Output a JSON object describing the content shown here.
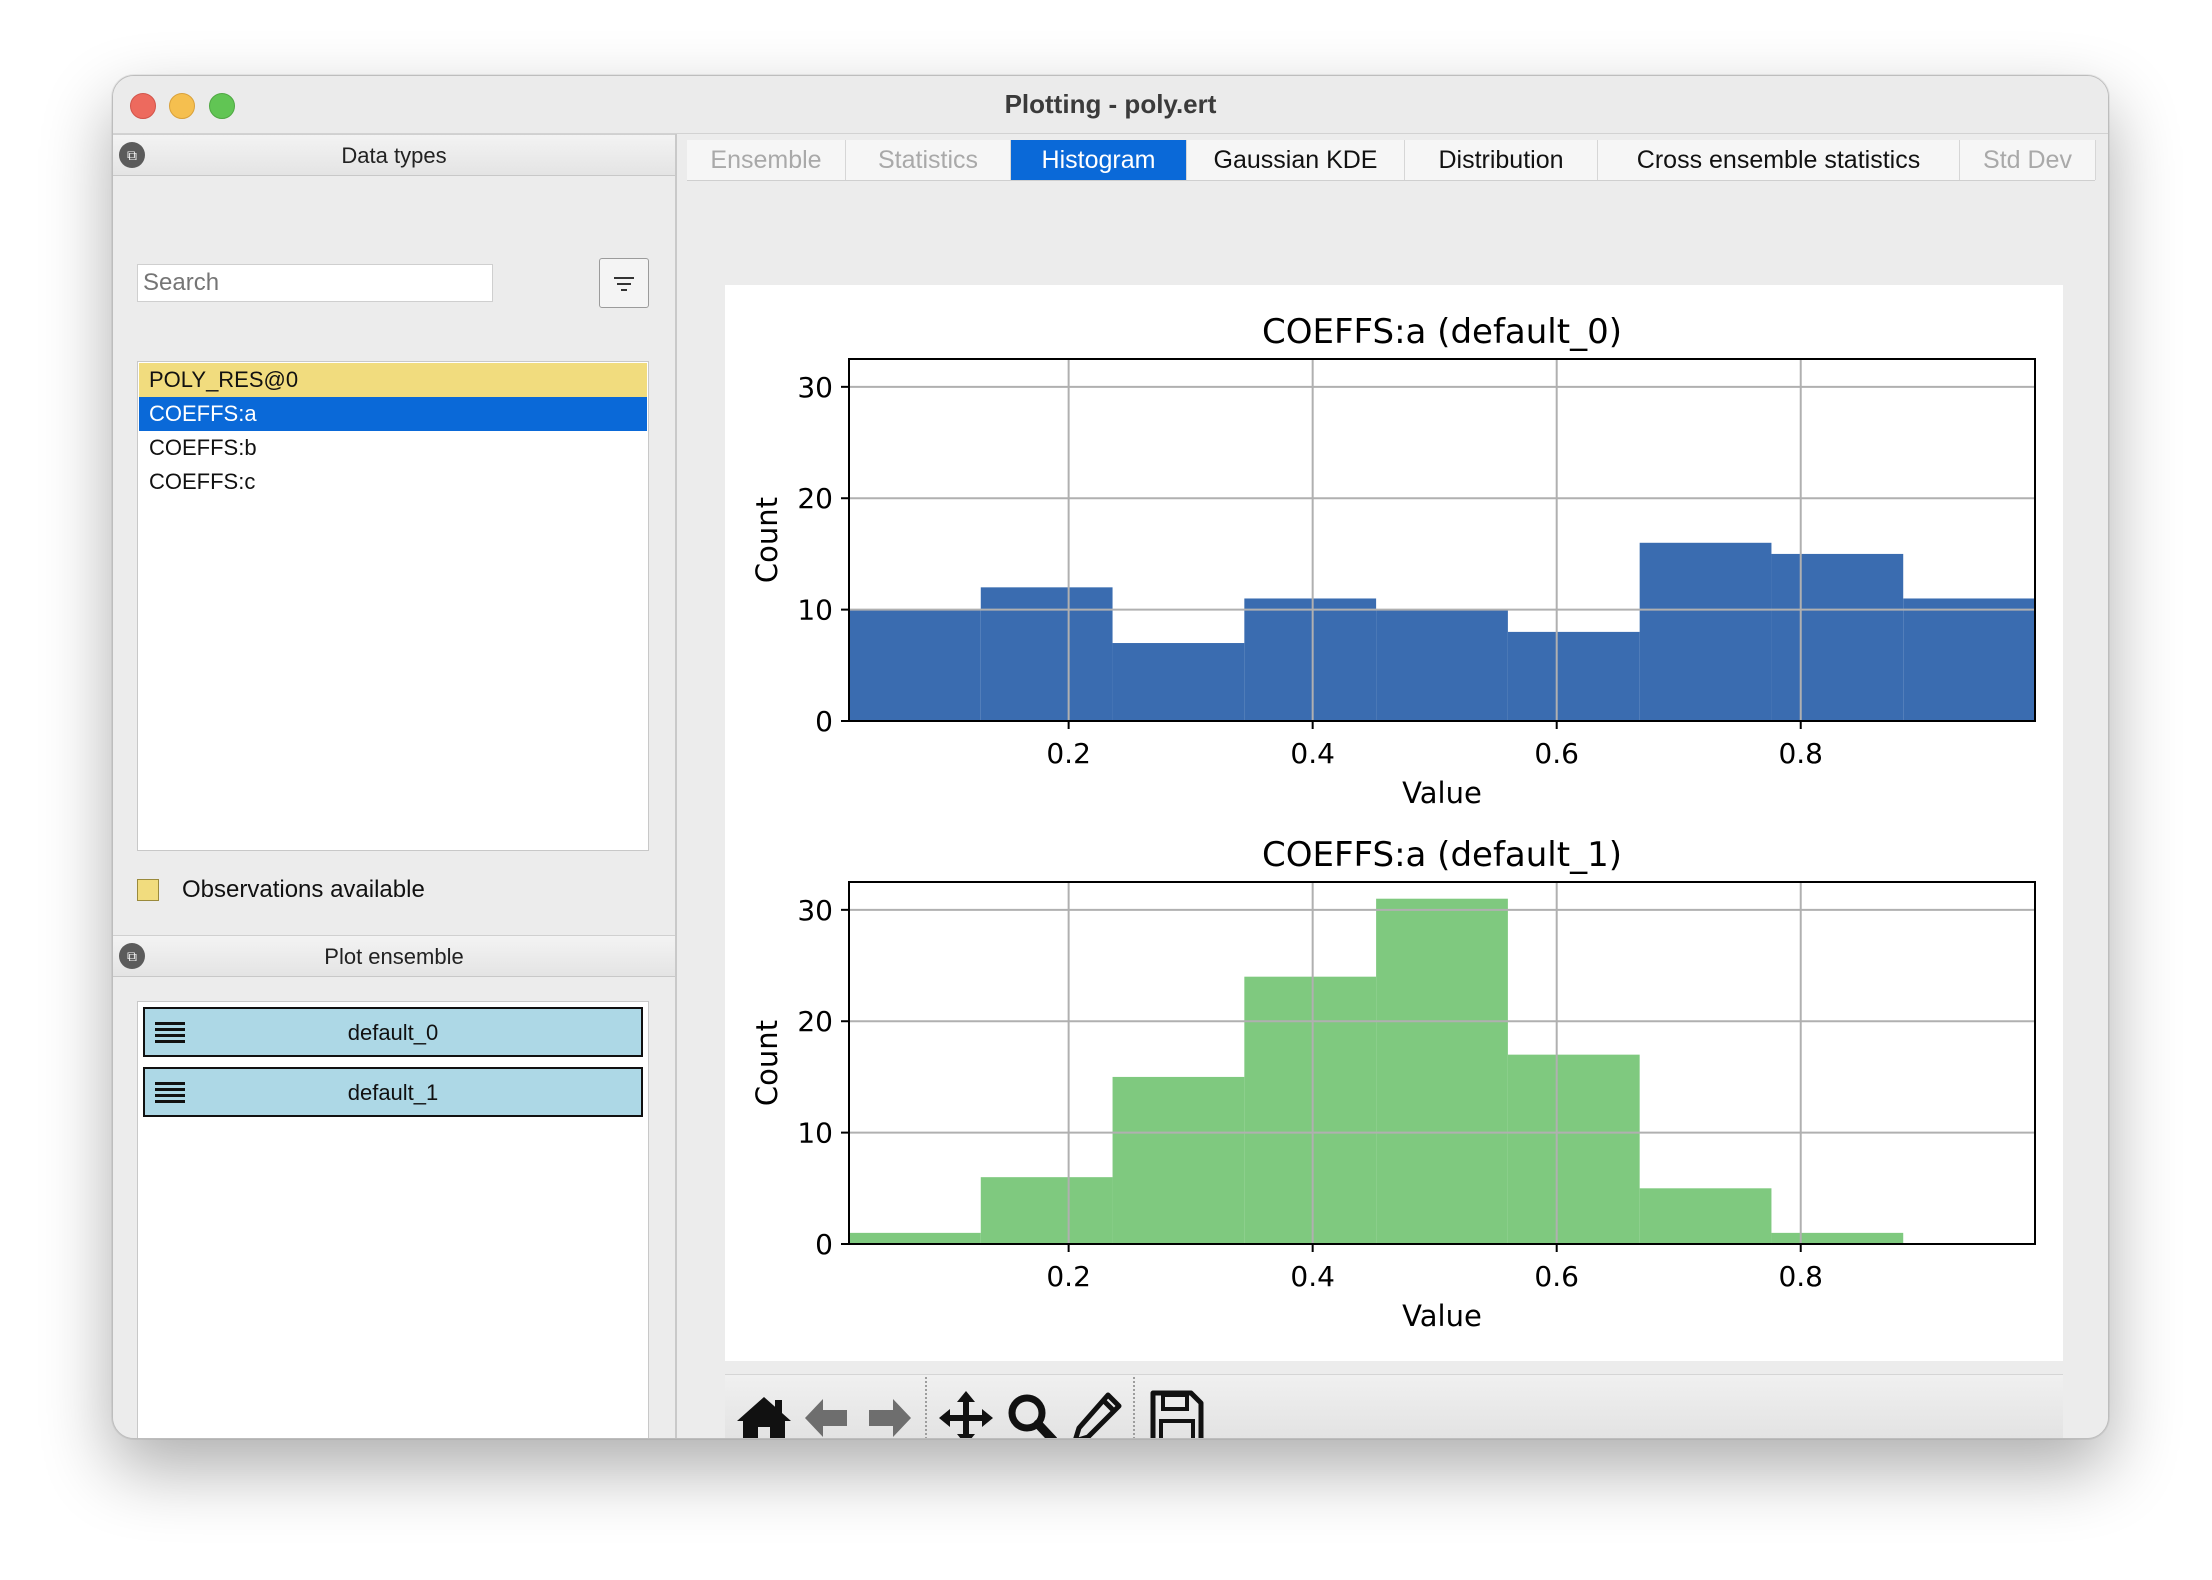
{
  "window": {
    "title": "Plotting - poly.ert"
  },
  "data_types": {
    "header": "Data types",
    "search_placeholder": "Search",
    "items": [
      {
        "label": "POLY_RES@0",
        "state": "observation"
      },
      {
        "label": "COEFFS:a",
        "state": "selected"
      },
      {
        "label": "COEFFS:b",
        "state": "normal"
      },
      {
        "label": "COEFFS:c",
        "state": "normal"
      }
    ],
    "observations_label": "Observations available",
    "colors": {
      "observation": "#f1dc7e",
      "selected": "#0a69d8"
    }
  },
  "plot_ensemble": {
    "header": "Plot ensemble",
    "items": [
      "default_0",
      "default_1"
    ],
    "item_color": "#add8e6"
  },
  "tabs": [
    {
      "label": "Ensemble",
      "state": "disabled"
    },
    {
      "label": "Statistics",
      "state": "disabled"
    },
    {
      "label": "Histogram",
      "state": "active"
    },
    {
      "label": "Gaussian KDE",
      "state": "normal"
    },
    {
      "label": "Distribution",
      "state": "normal"
    },
    {
      "label": "Cross ensemble statistics",
      "state": "normal"
    },
    {
      "label": "Std Dev",
      "state": "disabled"
    }
  ],
  "toolbar": {
    "buttons": [
      "home-icon",
      "back-arrow-icon",
      "forward-arrow-icon",
      "pan-icon",
      "zoom-icon",
      "edit-icon",
      "save-icon"
    ]
  },
  "chart_data": [
    {
      "type": "bar",
      "title": "COEFFS:a (default_0)",
      "xlabel": "Value",
      "ylabel": "Count",
      "color": "#3a6cb0",
      "bin_edges": [
        0.02,
        0.128,
        0.236,
        0.344,
        0.452,
        0.56,
        0.668,
        0.776,
        0.884,
        0.992
      ],
      "values": [
        10,
        12,
        7,
        11,
        10,
        8,
        16,
        15,
        11
      ],
      "xlim": [
        0.02,
        0.992
      ],
      "ylim": [
        0,
        32.5
      ],
      "xticks": [
        "0.2",
        "0.4",
        "0.6",
        "0.8"
      ],
      "yticks": [
        "0",
        "10",
        "20",
        "30"
      ],
      "grid": true
    },
    {
      "type": "bar",
      "title": "COEFFS:a (default_1)",
      "xlabel": "Value",
      "ylabel": "Count",
      "color": "#7fc97f",
      "bin_edges": [
        0.02,
        0.128,
        0.236,
        0.344,
        0.452,
        0.56,
        0.668,
        0.776,
        0.884,
        0.992
      ],
      "values": [
        1,
        6,
        15,
        24,
        31,
        17,
        5,
        1,
        0
      ],
      "xlim": [
        0.02,
        0.992
      ],
      "ylim": [
        0,
        32.5
      ],
      "xticks": [
        "0.2",
        "0.4",
        "0.6",
        "0.8"
      ],
      "yticks": [
        "0",
        "10",
        "20",
        "30"
      ],
      "grid": true
    }
  ]
}
